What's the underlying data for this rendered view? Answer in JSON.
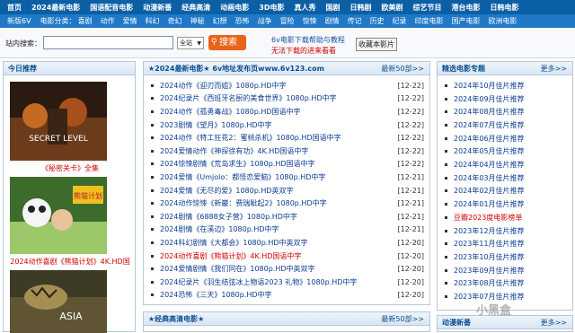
{
  "topnav": [
    "首页",
    "2024最新电影",
    "国语配音电影",
    "动漫新番",
    "经典高清",
    "动画电影",
    "3D电影",
    "真人秀",
    "国剧",
    "日韩剧",
    "欧美剧",
    "综艺节目",
    "港台电影",
    "日韩电影"
  ],
  "subnav": {
    "first": "新版6V",
    "label": "电影分类：",
    "items": [
      "喜剧",
      "动作",
      "爱情",
      "科幻",
      "奇幻",
      "神秘",
      "幻想",
      "恐怖",
      "战争",
      "冒险",
      "惊悚",
      "剧情",
      "传记",
      "历史",
      "纪录",
      "印度电影",
      "国产电影",
      "欧洲电影"
    ]
  },
  "search": {
    "label": "站内搜索：",
    "value": "",
    "scope": "全站",
    "button": "搜索",
    "help": "6v电影下载帮助与教程",
    "warn": "无法下载的进来看看",
    "favorite": "收藏本影片"
  },
  "left": {
    "title": "今日推荐",
    "items": [
      {
        "caption": "《秘密关卡》全集",
        "poster_text": "SECRET LEVEL",
        "poster_colors": [
          "#2a1a10",
          "#c46a24"
        ]
      },
      {
        "caption": "2024动作喜剧《熊猫计划》4K.HD国",
        "poster_text": "熊猫计划",
        "poster_colors": [
          "#3d6b2b",
          "#9cc86a"
        ]
      },
      {
        "caption": "",
        "poster_text": "ASIA",
        "poster_colors": [
          "#3d3a26",
          "#a58e52"
        ]
      }
    ]
  },
  "mid": {
    "title": "★2024最新电影★ 6v地址发布页www.6v123.com",
    "more": "最新50部>>",
    "rows": [
      {
        "title": "2024动作《迎刃而姐》1080p.HD中字",
        "date": "[12-22]",
        "hot": false
      },
      {
        "title": "2024纪录片《西班牙名厨的美食世界》1080p.HD中字",
        "date": "[12-22]",
        "hot": false
      },
      {
        "title": "2024动作《孤勇毒战》1080p.HD国语中字",
        "date": "[12-22]",
        "hot": false
      },
      {
        "title": "2023剧情《望月》1080p.HD中字",
        "date": "[12-22]",
        "hot": false
      },
      {
        "title": "2024动作《特工狂花2：蜜桃杀机》1080p.HD国语中字",
        "date": "[12-22]",
        "hot": false
      },
      {
        "title": "2024爱情动作《神探徐有功》4K.HD国语中字",
        "date": "[12-22]",
        "hot": false
      },
      {
        "title": "2024惊悚剧情《荒岛求生》1080p.HD国语中字",
        "date": "[12-22]",
        "hot": false
      },
      {
        "title": "2024爱情《Umjolo：都怪恋爱脑》1080p.HD中字",
        "date": "[12-21]",
        "hot": false
      },
      {
        "title": "2024爱情《无尽的爱》1080p.HD英双字",
        "date": "[12-21]",
        "hot": false
      },
      {
        "title": "2024动作惊悚《新巖：费瑞眦起2》1080p.HD中字",
        "date": "[12-21]",
        "hot": false
      },
      {
        "title": "2024剧情《6888女子营》1080p.HD中字",
        "date": "[12-21]",
        "hot": false
      },
      {
        "title": "2024剧情《在溪边》1080p.HD中字",
        "date": "[12-21]",
        "hot": false
      },
      {
        "title": "2024科幻剧情《大都会》1080p.HD中英双字",
        "date": "[12-20]",
        "hot": false
      },
      {
        "title": "2024动作喜剧《熊猫计划》4K.HD国语中字",
        "date": "[12-20]",
        "hot": true
      },
      {
        "title": "2024爱情剧情《我们同在》1080p.HD中英双字",
        "date": "[12-20]",
        "hot": false
      },
      {
        "title": "2024纪录片《羽生结弦冰上物语2023 礼物》1080p.HD中字",
        "date": "[12-20]",
        "hot": false
      },
      {
        "title": "2024恐怖《三天》1080p.HD中字",
        "date": "[12-20]",
        "hot": false
      }
    ]
  },
  "mid2": {
    "title": "★经典高清电影★",
    "more": "最新50部>>"
  },
  "right": {
    "title": "精选电影专题",
    "more": "更多>>",
    "items": [
      {
        "label": "2024年10月佳片推荐",
        "hot": false
      },
      {
        "label": "2024年09月佳片推荐",
        "hot": false
      },
      {
        "label": "2024年08月佳片推荐",
        "hot": false
      },
      {
        "label": "2024年07月佳片推荐",
        "hot": false
      },
      {
        "label": "2024年06月佳片推荐",
        "hot": false
      },
      {
        "label": "2024年05月佳片推荐",
        "hot": false
      },
      {
        "label": "2024年04月佳片推荐",
        "hot": false
      },
      {
        "label": "2024年03月佳片推荐",
        "hot": false
      },
      {
        "label": "2024年02月佳片推荐",
        "hot": false
      },
      {
        "label": "2024年01月佳片推荐",
        "hot": false
      },
      {
        "label": "豆瓣2023度电影榜单",
        "hot": true
      },
      {
        "label": "2023年12月佳片推荐",
        "hot": false
      },
      {
        "label": "2023年11月佳片推荐",
        "hot": false
      },
      {
        "label": "2023年10月佳片推荐",
        "hot": false
      },
      {
        "label": "2023年09月佳片推荐",
        "hot": false
      },
      {
        "label": "2023年08月佳片推荐",
        "hot": false
      },
      {
        "label": "2023年07月佳片推荐",
        "hot": false
      }
    ]
  },
  "right2": {
    "title": "动漫新番",
    "more": "更多>>"
  },
  "watermark": "小黑盒"
}
